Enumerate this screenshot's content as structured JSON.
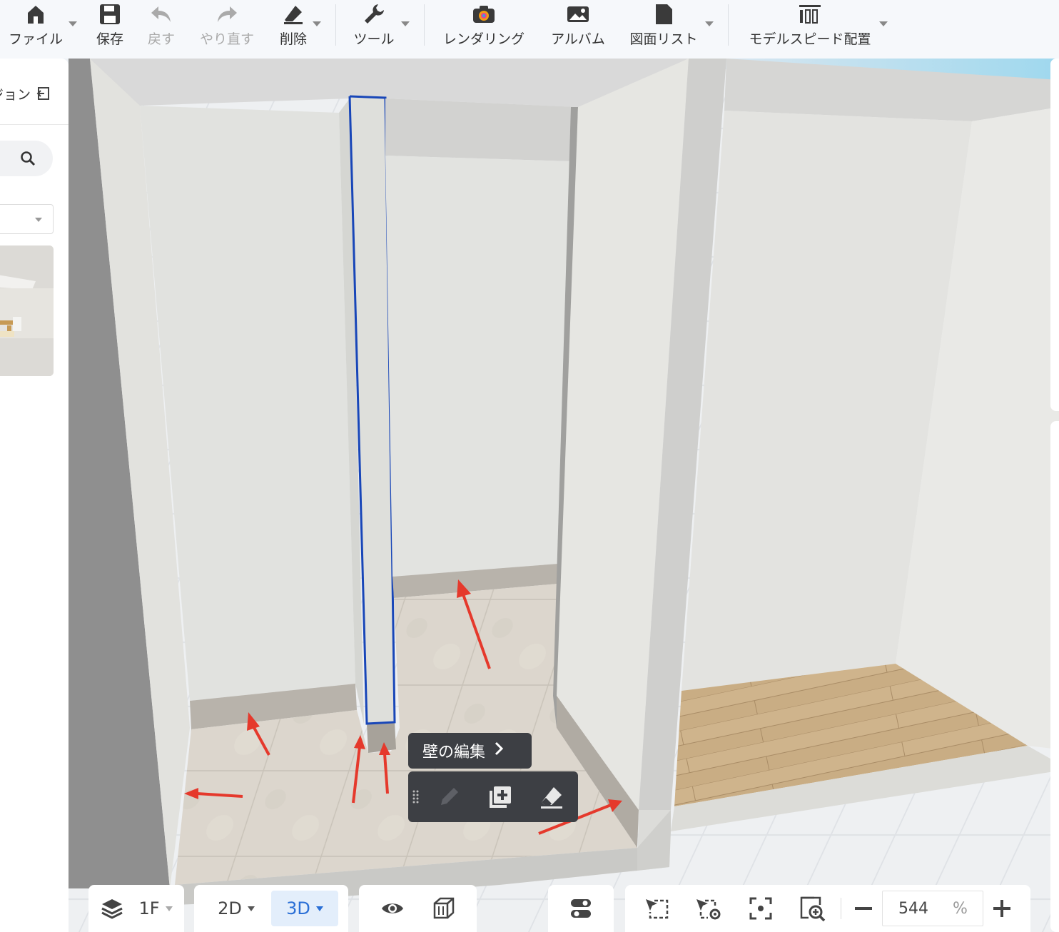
{
  "toolbar": {
    "file": "ファイル",
    "save": "保存",
    "undo": "戻す",
    "redo": "やり直す",
    "delete": "削除",
    "tools": "ツール",
    "rendering": "レンダリング",
    "album": "アルバム",
    "drawing_list": "図面リスト",
    "model_speed": "モデルスピード配置"
  },
  "left_panel": {
    "title": "ジョン"
  },
  "popup": {
    "edit_wall": "壁の編集"
  },
  "bottom_bar": {
    "floor": "1F",
    "view_2d": "2D",
    "view_3d": "3D",
    "active_view": "3D",
    "zoom_value": "544",
    "zoom_unit": "%"
  },
  "colors": {
    "selection_outline": "#1846b8",
    "annotation_arrows": "#e5392c",
    "active_view_bg": "#e3eefb",
    "active_view_text": "#2a6fd6",
    "popup_bg": "#3d3f44"
  }
}
